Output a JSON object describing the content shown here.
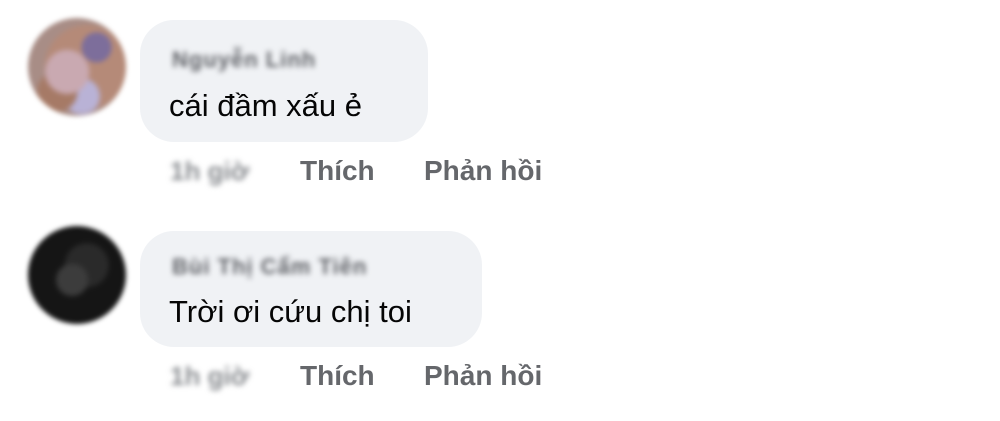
{
  "comments": [
    {
      "author": "Nguyễn Linh",
      "text": "cái đầm xấu ẻ",
      "timestamp": "1h giờ",
      "like_label": "Thích",
      "reply_label": "Phản hồi"
    },
    {
      "author": "Bùi Thị Cẩm Tiên",
      "text": "Trời ơi cứu chị toi",
      "timestamp": "1h giờ",
      "like_label": "Thích",
      "reply_label": "Phản hồi"
    }
  ],
  "colors": {
    "bubble_bg": "#f0f2f5",
    "text": "#050505",
    "action_text": "#65676b"
  }
}
